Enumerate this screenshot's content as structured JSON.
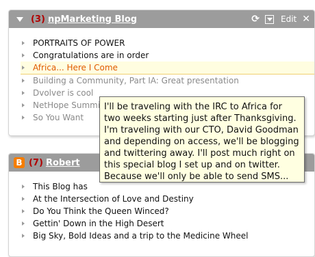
{
  "widgets": [
    {
      "count": "(3)",
      "title": "npMarketing Blog",
      "edit_label": "Edit",
      "refresh_glyph": "⟳",
      "close_glyph": "✕",
      "items": [
        {
          "text": "PORTRAITS OF POWER"
        },
        {
          "text": "Congratulations are in order"
        },
        {
          "text": "Africa... Here I Come"
        },
        {
          "text": "Building a Community, Part IA: Great presentation"
        },
        {
          "text": "Dvolver is cool"
        },
        {
          "text": "NetHope Summit"
        },
        {
          "text": "So You Want"
        }
      ]
    },
    {
      "icon_glyph": "B",
      "count": "(7)",
      "title": "Robert",
      "items": [
        {
          "text": "This Blog has"
        },
        {
          "text": "At the Intersection of Love and Destiny"
        },
        {
          "text": "Do You Think the Queen Winced?"
        },
        {
          "text": "Gettin' Down in the High Desert"
        },
        {
          "text": "Big Sky, Bold Ideas and a trip to the Medicine Wheel"
        }
      ]
    }
  ],
  "tooltip": {
    "text": "I'll be traveling with the IRC to Africa for two weeks starting just after Thanksgiving. I'm traveling with our CTO, David Goodman and depending on access, we'll be blogging and twittering away. I'll post much right on this special blog I set up and on twitter. Because we'll only be able to send SMS..."
  },
  "colors": {
    "header_bg": "#9c9c9c",
    "count_red": "#b00000",
    "hover_orange": "#e05a00",
    "tooltip_bg": "#ffffe1",
    "blogger_orange": "#f57d00"
  }
}
